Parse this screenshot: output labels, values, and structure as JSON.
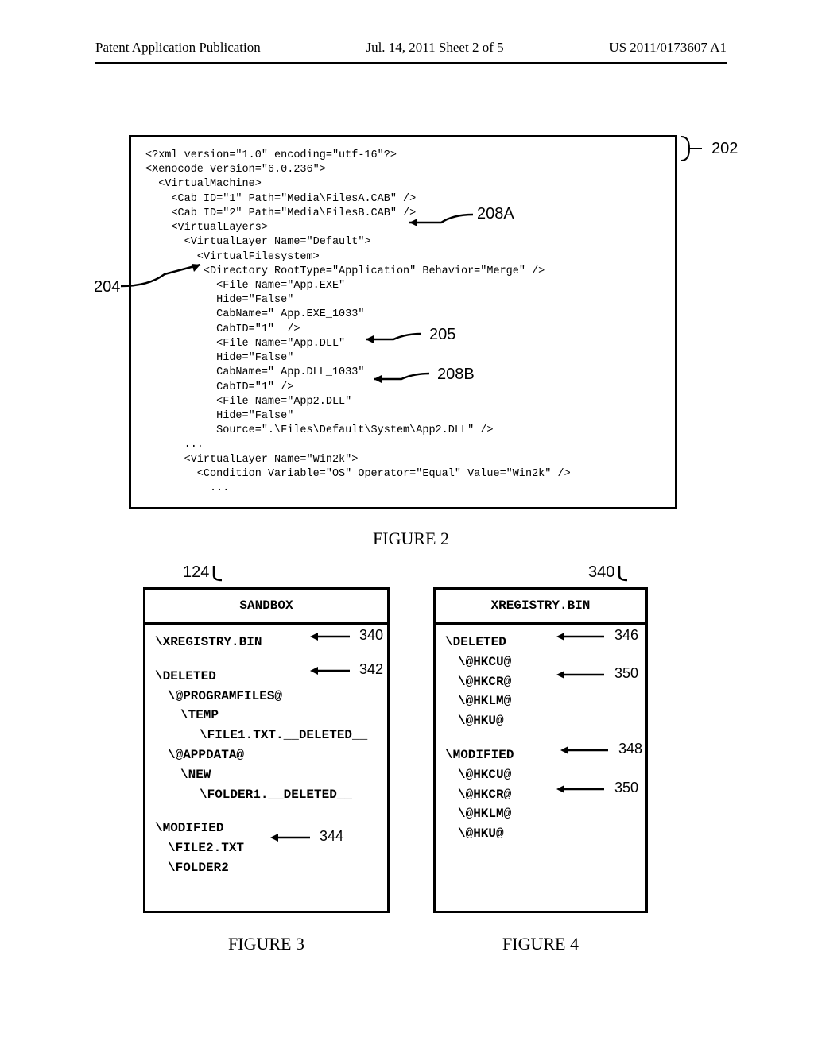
{
  "header": {
    "left": "Patent Application Publication",
    "center": "Jul. 14, 2011    Sheet 2 of 5",
    "right": "US 2011/0173607 A1"
  },
  "fig2": {
    "xml_lines": "<?xml version=\"1.0\" encoding=\"utf-16\"?>\n<Xenocode Version=\"6.0.236\">\n  <VirtualMachine>\n    <Cab ID=\"1\" Path=\"Media\\FilesA.CAB\" />\n    <Cab ID=\"2\" Path=\"Media\\FilesB.CAB\" />\n    <VirtualLayers>\n      <VirtualLayer Name=\"Default\">\n        <VirtualFilesystem>\n         <Directory RootType=\"Application\" Behavior=\"Merge\" />\n           <File Name=\"App.EXE\"\n           Hide=\"False\"\n           CabName=\" App.EXE_1033\"\n           CabID=\"1\"  />\n           <File Name=\"App.DLL\"\n           Hide=\"False\"\n           CabName=\" App.DLL_1033\"\n           CabID=\"1\" />\n           <File Name=\"App2.DLL\"\n           Hide=\"False\"\n           Source=\".\\Files\\Default\\System\\App2.DLL\" />\n      ...\n      <VirtualLayer Name=\"Win2k\">\n        <Condition Variable=\"OS\" Operator=\"Equal\" Value=\"Win2k\" />\n          ...",
    "caption": "FIGURE 2",
    "labels": {
      "l202": "202",
      "l204": "204",
      "l205": "205",
      "l208A": "208A",
      "l208B": "208B"
    }
  },
  "fig3": {
    "toplabel": "124",
    "title": "SANDBOX",
    "lines": {
      "l1": "\\XREGISTRY.BIN",
      "l2": "\\DELETED",
      "l3": "\\@PROGRAMFILES@",
      "l4": "\\TEMP",
      "l5": "\\FILE1.TXT.__DELETED__",
      "l6": "\\@APPDATA@",
      "l7": "\\NEW",
      "l8": "\\FOLDER1.__DELETED__",
      "l9": "\\MODIFIED",
      "l10": "\\FILE2.TXT",
      "l11": "\\FOLDER2"
    },
    "labels": {
      "l340": "340",
      "l342": "342",
      "l344": "344"
    },
    "caption": "FIGURE 3"
  },
  "fig4": {
    "toplabel": "340",
    "title": "XREGISTRY.BIN",
    "lines": {
      "l1": "\\DELETED",
      "l2": "\\@HKCU@",
      "l3": "\\@HKCR@",
      "l4": "\\@HKLM@",
      "l5": "\\@HKU@",
      "l6": "\\MODIFIED",
      "l7": "\\@HKCU@",
      "l8": "\\@HKCR@",
      "l9": "\\@HKLM@",
      "l10": "\\@HKU@"
    },
    "labels": {
      "l346": "346",
      "l348": "348",
      "l350a": "350",
      "l350b": "350"
    },
    "caption": "FIGURE 4"
  }
}
